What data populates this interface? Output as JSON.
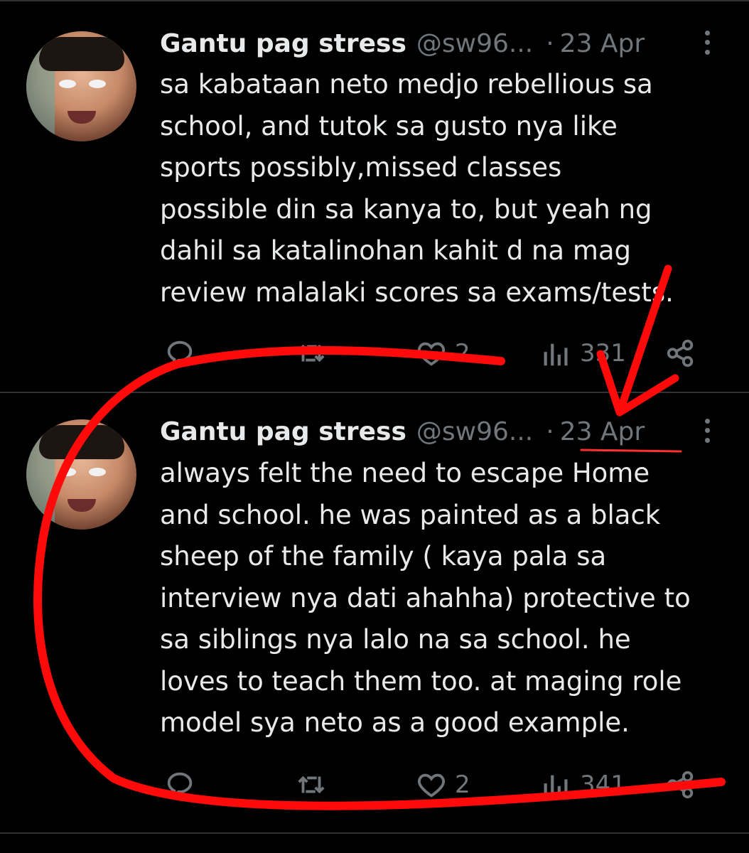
{
  "tweets": [
    {
      "author_name": "Gantu pag stress",
      "handle": "@sw96...",
      "separator": "·",
      "date": "23 Apr",
      "text": "sa kabataan neto medjo rebellious sa\nschool, and tutok sa gusto nya like\nsports possibly,missed classes\npossible din sa kanya to, but yeah ng\ndahil sa katalinohan kahit d na mag\nreview malalaki scores sa exams/tests.",
      "like_count": "2",
      "view_count": "331"
    },
    {
      "author_name": "Gantu pag stress",
      "handle": "@sw96...",
      "separator": "·",
      "date": "23 Apr",
      "text": "always felt the need to escape Home\nand school. he was painted as a black\nsheep of the family ( kaya pala sa\ninterview nya dati ahahha) protective to\nsa siblings nya  lalo na sa school. he\nloves to teach them too. at maging role\nmodel sya neto as a good example.",
      "like_count": "2",
      "view_count": "341"
    }
  ],
  "icons": {
    "reply": "reply-icon",
    "retweet": "retweet-icon",
    "like": "heart-icon",
    "views": "views-icon",
    "share": "share-icon",
    "more": "more-icon"
  },
  "colors": {
    "background": "#000000",
    "text": "#e7e9ea",
    "muted": "#71767b",
    "divider": "#2f3336",
    "annotation": "#ff0a0a"
  }
}
